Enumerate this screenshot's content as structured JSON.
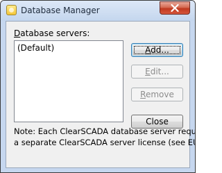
{
  "window": {
    "title": "Database Manager",
    "app_icon": "database-manager-app-icon",
    "close_icon": "close-icon"
  },
  "servers_label": {
    "pre": "",
    "mnemonic": "D",
    "post": "atabase servers:"
  },
  "servers_list": {
    "items": [
      "(Default)"
    ]
  },
  "buttons": {
    "add": {
      "mnemonic": "A",
      "rest": "dd...",
      "enabled": true
    },
    "edit": {
      "mnemonic": "E",
      "rest": "dit...",
      "enabled": false
    },
    "remove": {
      "mnemonic": "R",
      "rest": "emove",
      "enabled": false
    },
    "close": {
      "label": "Close",
      "enabled": true
    }
  },
  "note": {
    "line1": "Note: Each ClearSCADA database server requires",
    "line2": "a separate ClearSCADA server license (see EULA)."
  },
  "colors": {
    "frame": "#c6d7ef",
    "client": "#f0f0f0",
    "close_button": "#c0391f"
  }
}
